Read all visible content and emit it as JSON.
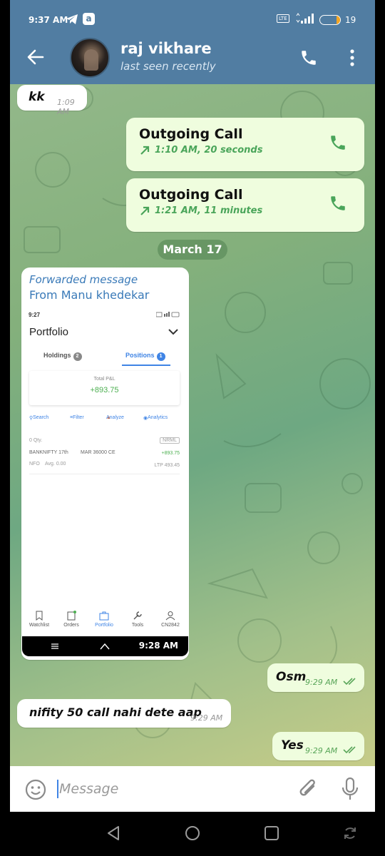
{
  "status_bar": {
    "time": "9:37 AM",
    "app_badge": "a",
    "volte": "LTE",
    "battery": "19",
    "battery_level": 0.19
  },
  "header": {
    "name": "raj vikhare",
    "status": "last seen recently"
  },
  "messages": [
    {
      "type": "text_in",
      "text": "kk",
      "time": "1:09 AM"
    },
    {
      "type": "call_out",
      "title": "Outgoing Call",
      "detail": "1:10 AM, 20 seconds"
    },
    {
      "type": "call_out",
      "title": "Outgoing Call",
      "detail": "1:21 AM, 11 minutes"
    }
  ],
  "date_separator": "March 17",
  "forwarded": {
    "label": "Forwarded message",
    "from_prefix": "From",
    "from_name": "Manu khedekar",
    "screenshot": {
      "status_time": "9:27",
      "title": "Portfolio",
      "tab_holdings": "Holdings",
      "tab_holdings_count": "2",
      "tab_positions": "Positions",
      "tab_positions_count": "1",
      "pl_label": "Total P&L",
      "pl_value": "+893.75",
      "tools": [
        "Search",
        "Filter",
        "Analyze",
        "Analytics"
      ],
      "position": {
        "qty": "0 Qty.",
        "product": "NRML",
        "symbol": "BANKNIFTY 17th",
        "contract": "MAR 36000 CE",
        "pnl": "+893.75",
        "exchange": "NFO",
        "avg": "Avg. 0.00",
        "ltp": "LTP 493.45"
      },
      "nav": [
        "Watchlist",
        "Orders",
        "Portfolio",
        "Tools",
        "CN2842"
      ],
      "time": "9:28 AM"
    }
  },
  "messages_after": [
    {
      "type": "text_out",
      "text": "Osm",
      "time": "9:29 AM"
    },
    {
      "type": "text_in",
      "text": "nifity 50 call nahi dete aap",
      "time": "9:29 AM"
    },
    {
      "type": "text_out",
      "text": "Yes",
      "time": "9:29 AM"
    }
  ],
  "input": {
    "placeholder": "Message"
  },
  "colors": {
    "header": "#517da2",
    "outgoing": "#effdde",
    "accent_green": "#4aa55a",
    "link_blue": "#3a7ab8"
  }
}
